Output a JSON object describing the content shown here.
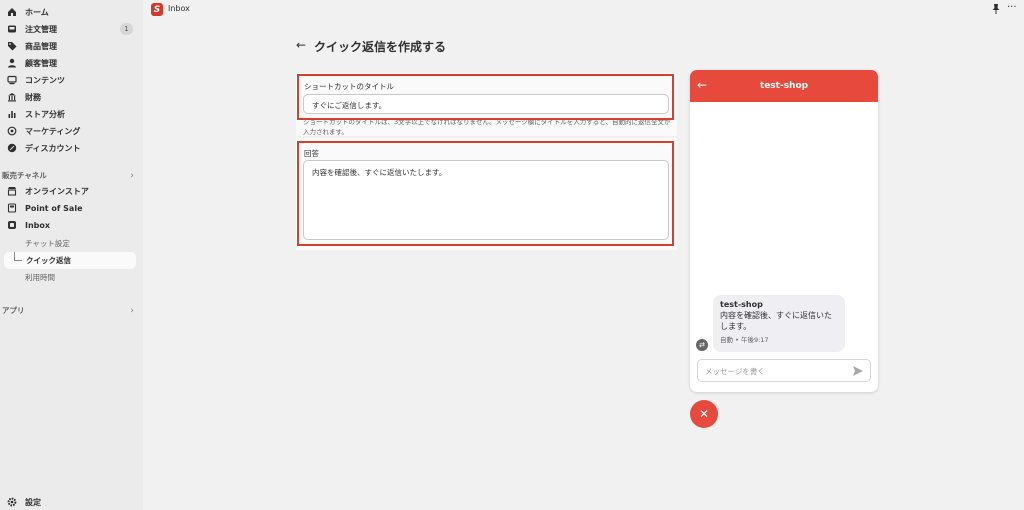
{
  "sidebar": {
    "items": [
      {
        "label": "ホーム",
        "icon": "home-icon"
      },
      {
        "label": "注文管理",
        "icon": "inbox-tray-icon",
        "badge": "1"
      },
      {
        "label": "商品管理",
        "icon": "tag-icon"
      },
      {
        "label": "顧客管理",
        "icon": "person-icon"
      },
      {
        "label": "コンテンツ",
        "icon": "content-icon"
      },
      {
        "label": "財務",
        "icon": "bank-icon"
      },
      {
        "label": "ストア分析",
        "icon": "bar-chart-icon"
      },
      {
        "label": "マーケティング",
        "icon": "target-icon"
      },
      {
        "label": "ディスカウント",
        "icon": "discount-icon"
      }
    ],
    "sales_channels_label": "販売チャネル",
    "channels": [
      {
        "label": "オンラインストア",
        "icon": "storefront-icon"
      },
      {
        "label": "Point of Sale",
        "icon": "pos-icon"
      },
      {
        "label": "Inbox",
        "icon": "inbox-app-icon"
      }
    ],
    "inbox_sub": {
      "chat_settings": "チャット設定",
      "quick_replies": "クイック返信",
      "hours": "利用時間"
    },
    "apps_label": "アプリ",
    "settings_label": "設定"
  },
  "topbar": {
    "app_logo_letter": "S",
    "app_name": "Inbox"
  },
  "page": {
    "back_arrow": "←",
    "title": "クイック返信を作成する"
  },
  "form": {
    "shortcut_title_label": "ショートカットのタイトル",
    "shortcut_title_value": "すぐにご返信します。",
    "help_text": "ショートカットのタイトルは、3文字以上でなければなりません。メッセージ欄にタイトルを入力すると、自動的に返信全文が入力されます。",
    "reply_label": "回答",
    "reply_value": "内容を確認後、すぐに返信いたします。"
  },
  "preview": {
    "shop_name": "test-shop",
    "back_arrow": "←",
    "bubble_name": "test-shop",
    "bubble_text": "内容を確認後、すぐに返信いたします。",
    "bubble_meta": "自動 • 午後9:17",
    "message_placeholder": "メッセージを書く",
    "close_symbol": "✕"
  },
  "colors": {
    "accent": "#e8493d",
    "highlight_border": "#d2402e",
    "sidebar_bg": "#ebebeb",
    "page_bg": "#f1f1f1"
  }
}
